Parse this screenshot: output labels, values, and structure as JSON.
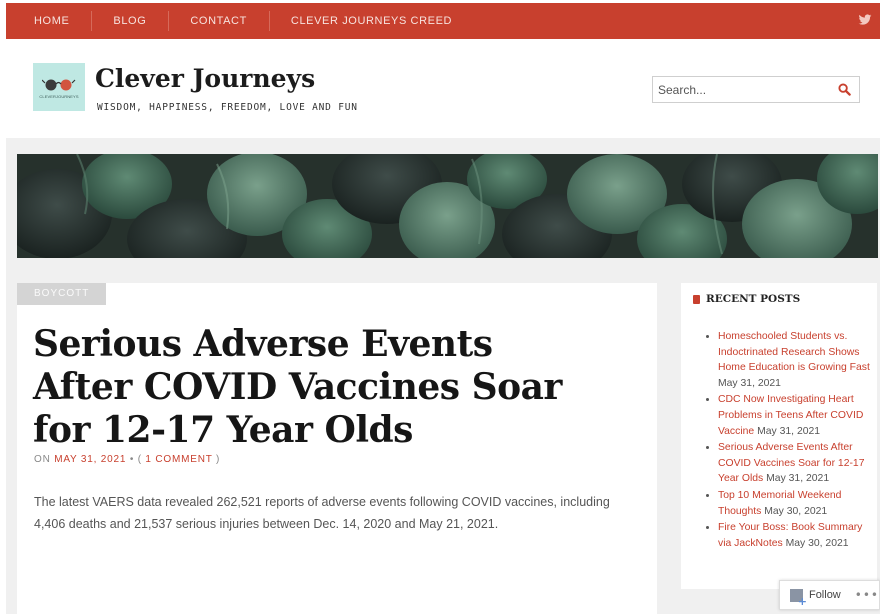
{
  "nav": {
    "items": [
      {
        "label": "HOME"
      },
      {
        "label": "BLOG"
      },
      {
        "label": "CONTACT"
      },
      {
        "label": "CLEVER JOURNEYS CREED"
      }
    ],
    "social_icon": "twitter-icon"
  },
  "header": {
    "logo_text": "CLEVERJOURNEYS",
    "title": "Clever Journeys",
    "tagline": "WISDOM, HAPPINESS, FREEDOM, LOVE AND FUN"
  },
  "search": {
    "placeholder": "Search..."
  },
  "article": {
    "category": "BOYCOTT",
    "title": "Serious Adverse Events After COVID Vaccines Soar for 12-17 Year Olds",
    "meta_prefix": "ON ",
    "date": "MAY 31, 2021",
    "meta_sep": " • ( ",
    "comments": "1 COMMENT",
    "meta_suffix": " )",
    "excerpt": "The latest VAERS data revealed 262,521 reports of adverse events following COVID vaccines, including 4,406 deaths and 21,537 serious injuries between Dec. 14, 2020 and May 21, 2021."
  },
  "sidebar": {
    "widget_title": "RECENT POSTS",
    "posts": [
      {
        "title": "Homeschooled Students vs. Indoctrinated Research Shows Home Education is Growing Fast",
        "date": " May 31, 2021"
      },
      {
        "title": "CDC Now Investigating Heart Problems in Teens After COVID Vaccine",
        "date": " May 31, 2021"
      },
      {
        "title": "Serious Adverse Events After COVID Vaccines Soar for 12-17 Year Olds",
        "date": " May 31, 2021"
      },
      {
        "title": "Top 10 Memorial Weekend Thoughts",
        "date": " May 30, 2021"
      },
      {
        "title": "Fire Your Boss: Book Summary via JackNotes",
        "date": " May 30, 2021"
      }
    ]
  },
  "follow": {
    "label": "Follow",
    "more": "•••"
  },
  "colors": {
    "accent": "#c8402e",
    "band": "#f0f0f0"
  }
}
